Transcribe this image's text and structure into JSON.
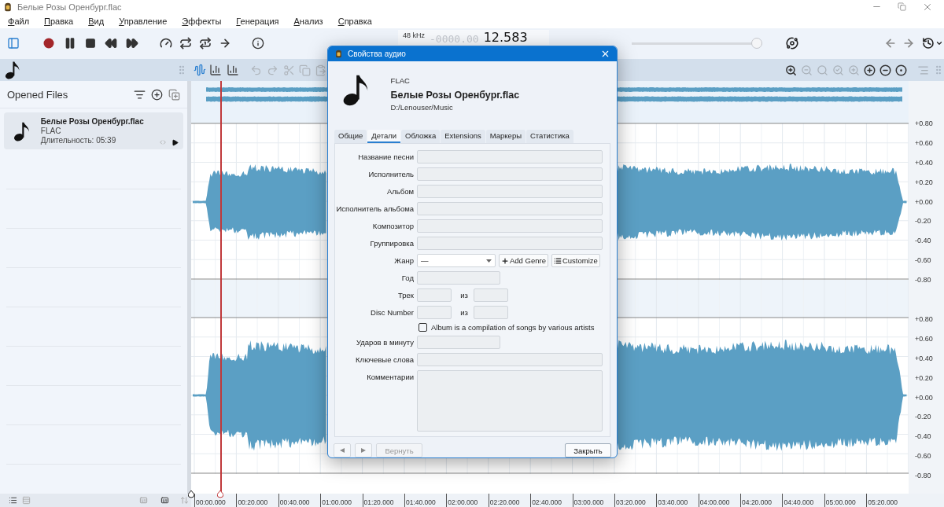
{
  "window": {
    "title": "Белые Розы Оренбург.flac"
  },
  "menu": [
    {
      "label": "Файл"
    },
    {
      "label": "Правка"
    },
    {
      "label": "Вид"
    },
    {
      "label": "Управление"
    },
    {
      "label": "Эффекты"
    },
    {
      "label": "Генерация"
    },
    {
      "label": "Анализ"
    },
    {
      "label": "Справка"
    }
  ],
  "transport": {
    "sample_rate": "48 kHz",
    "time_dim": "-0000.00",
    "time": "12.583",
    "volume": {
      "level": 1
    }
  },
  "sidebar": {
    "title": "Opened Files",
    "files": [
      {
        "name": "Белые Розы Оренбург.flac",
        "format": "FLAC",
        "duration": "Длительность: 05:39",
        "selected": true
      }
    ]
  },
  "waveform": {
    "channels": [
      {
        "scale": [
          "+0.80",
          "+0.60",
          "+0.40",
          "+0.20",
          "+0.00",
          "-0.20",
          "-0.40",
          "-0.60",
          "-0.80"
        ]
      },
      {
        "scale": [
          "+0.80",
          "+0.60",
          "+0.40",
          "+0.20",
          "+0.00",
          "-0.20",
          "-0.40",
          "-0.60",
          "-0.80"
        ]
      }
    ],
    "timeline": [
      "00:00.000",
      "00:20.000",
      "00:40.000",
      "01:00.000",
      "01:20.000",
      "01:40.000",
      "02:00.000",
      "02:20.000",
      "02:40.000",
      "03:00.000",
      "03:20.000",
      "03:40.000",
      "04:00.000",
      "04:20.000",
      "04:40.000",
      "05:00.000",
      "05:20.000"
    ]
  },
  "dialog": {
    "title": "Свойства аудио",
    "format": "FLAC",
    "file_name": "Белые Розы Оренбург.flac",
    "path": "D:/Lenouser/Music",
    "tabs": [
      {
        "label": "Общие",
        "selected": false
      },
      {
        "label": "Детали",
        "selected": true
      },
      {
        "label": "Обложка",
        "selected": false
      },
      {
        "label": "Extensions",
        "selected": false
      },
      {
        "label": "Маркеры",
        "selected": false
      },
      {
        "label": "Статистика",
        "selected": false
      }
    ],
    "fields": [
      {
        "kind": "text",
        "label": "Название песни"
      },
      {
        "kind": "text",
        "label": "Исполнитель"
      },
      {
        "kind": "text",
        "label": "Альбом"
      },
      {
        "kind": "text",
        "label": "Исполнитель альбома"
      },
      {
        "kind": "text",
        "label": "Композитор"
      },
      {
        "kind": "text",
        "label": "Группировка"
      },
      {
        "kind": "genre",
        "label": "Жанр",
        "dropdown_text": "—",
        "add_button": "Add Genre",
        "customize_button": "Customize"
      },
      {
        "kind": "short",
        "label": "Год"
      },
      {
        "kind": "pair",
        "label": "Трек",
        "separator": "из"
      },
      {
        "kind": "pair",
        "label": "Disc Number",
        "separator": "из"
      },
      {
        "kind": "checkbox",
        "label": "Album is a compilation of songs by various artists",
        "checked": false
      },
      {
        "kind": "short",
        "label": "Ударов в минуту"
      },
      {
        "kind": "text",
        "label": "Ключевые слова"
      },
      {
        "kind": "textarea",
        "label": "Комментарии"
      }
    ],
    "buttons": [
      {
        "label": "Вернуть",
        "disabled": true
      },
      {
        "label": "Закрыть",
        "disabled": false
      }
    ]
  }
}
